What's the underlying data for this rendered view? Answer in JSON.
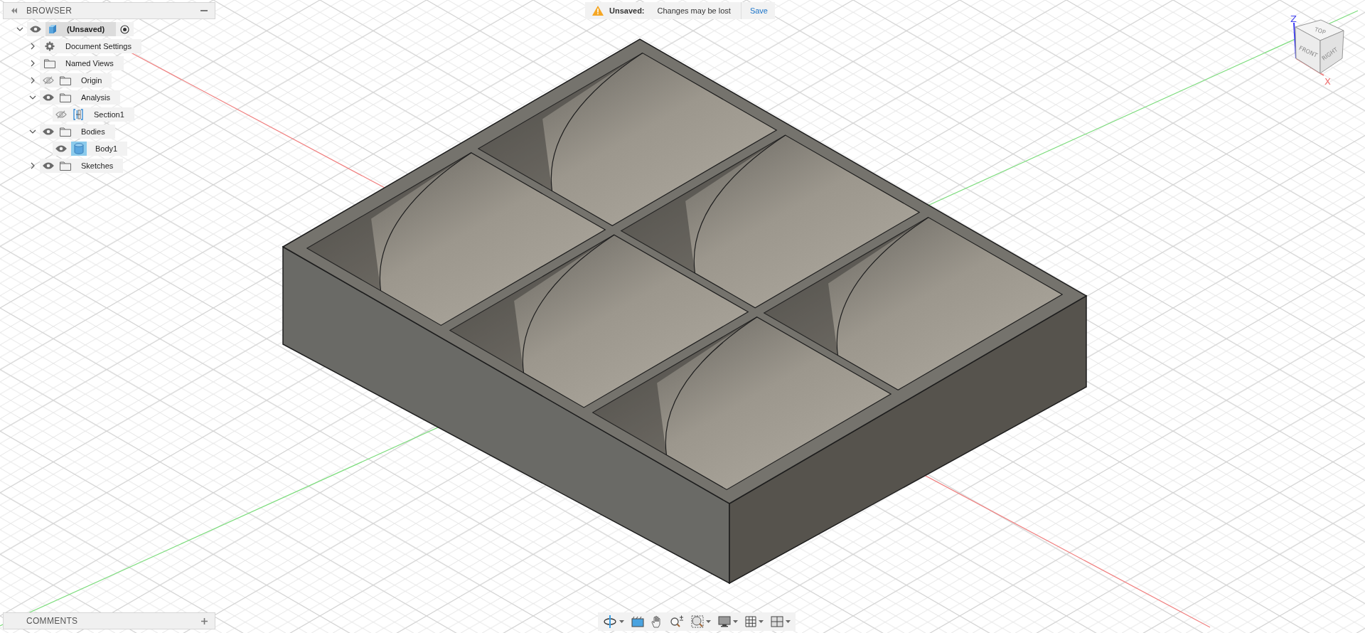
{
  "browser": {
    "title": "BROWSER",
    "tree": [
      {
        "label": "(Unsaved)",
        "kind": "component",
        "visible": true,
        "expanded": true,
        "active": true,
        "children": [
          {
            "label": "Document Settings",
            "kind": "settings",
            "expanded": false
          },
          {
            "label": "Named Views",
            "kind": "folder",
            "expanded": false
          },
          {
            "label": "Origin",
            "kind": "folder",
            "visible": false,
            "expanded": false
          },
          {
            "label": "Analysis",
            "kind": "folder",
            "visible": true,
            "expanded": true,
            "children": [
              {
                "label": "Section1",
                "kind": "section",
                "visible": false
              }
            ]
          },
          {
            "label": "Bodies",
            "kind": "folder",
            "visible": true,
            "expanded": true,
            "children": [
              {
                "label": "Body1",
                "kind": "body",
                "visible": true
              }
            ]
          },
          {
            "label": "Sketches",
            "kind": "folder",
            "visible": true,
            "expanded": false
          }
        ]
      }
    ]
  },
  "notification": {
    "title": "Unsaved:",
    "message": "Changes may be lost",
    "action": "Save"
  },
  "view_cube": {
    "top": "TOP",
    "front": "FRONT",
    "right": "RIGHT",
    "z_axis": "Z",
    "x_axis": "X"
  },
  "nav_toolbar": {
    "tools": [
      {
        "kind": "orbit",
        "dropdown": true
      },
      {
        "kind": "look_at",
        "dropdown": false
      },
      {
        "kind": "pan",
        "dropdown": false
      },
      {
        "kind": "zoom",
        "dropdown": false
      },
      {
        "kind": "fit",
        "dropdown": true
      },
      {
        "kind": "display",
        "dropdown": true
      },
      {
        "kind": "grid",
        "dropdown": true
      },
      {
        "kind": "viewports",
        "dropdown": true
      }
    ]
  },
  "comments": {
    "title": "COMMENTS"
  }
}
